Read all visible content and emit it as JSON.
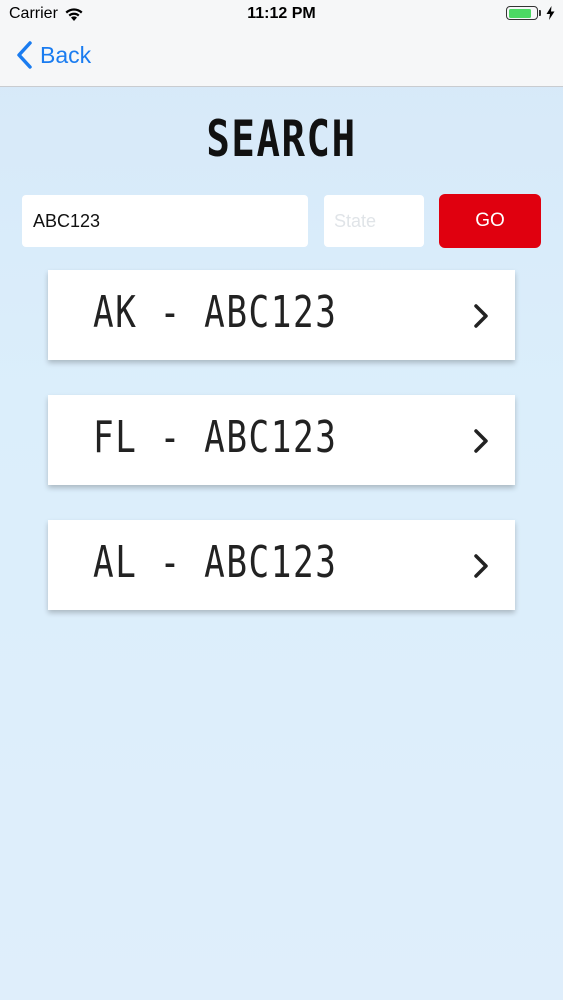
{
  "status_bar": {
    "carrier": "Carrier",
    "time": "11:12 PM",
    "battery_level": 0.85,
    "icons": [
      "wifi-icon",
      "battery-icon",
      "charging-bolt-icon"
    ]
  },
  "nav": {
    "back_label": "Back",
    "back_icon": "chevron-left-icon",
    "accent_color": "#1a7cf0"
  },
  "page": {
    "title": "SEARCH"
  },
  "search": {
    "plate_value": "ABC123",
    "state_placeholder": "State",
    "state_value": "",
    "go_label": "GO",
    "go_color": "#e0000f"
  },
  "results": [
    {
      "label": "AK - ABC123"
    },
    {
      "label": "FL - ABC123"
    },
    {
      "label": "AL - ABC123"
    }
  ]
}
